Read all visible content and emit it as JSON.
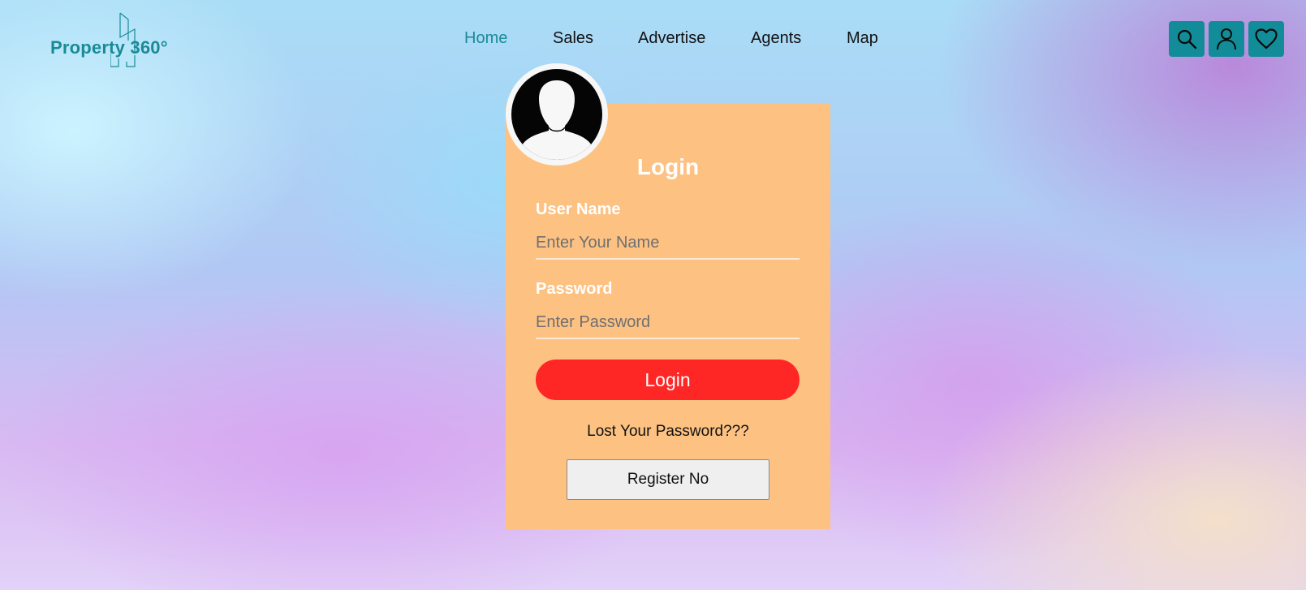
{
  "brand": {
    "name": "Property 360°",
    "color": "#1a8b96"
  },
  "nav": {
    "items": [
      {
        "label": "Home",
        "active": true
      },
      {
        "label": "Sales",
        "active": false
      },
      {
        "label": "Advertise",
        "active": false
      },
      {
        "label": "Agents",
        "active": false
      },
      {
        "label": "Map",
        "active": false
      }
    ]
  },
  "header_actions": {
    "icons": [
      "search-icon",
      "user-icon",
      "heart-icon"
    ],
    "button_color": "#138c99"
  },
  "login_card": {
    "title": "Login",
    "background_color": "#fdc282",
    "avatar_icon": "user-silhouette-icon",
    "username": {
      "label": "User Name",
      "placeholder": "Enter Your Name",
      "value": ""
    },
    "password": {
      "label": "Password",
      "placeholder": "Enter Password",
      "value": ""
    },
    "login_button": {
      "label": "Login",
      "color": "#ff2626"
    },
    "lost_password": "Lost Your Password???",
    "register_button": {
      "label": "Register No"
    }
  }
}
